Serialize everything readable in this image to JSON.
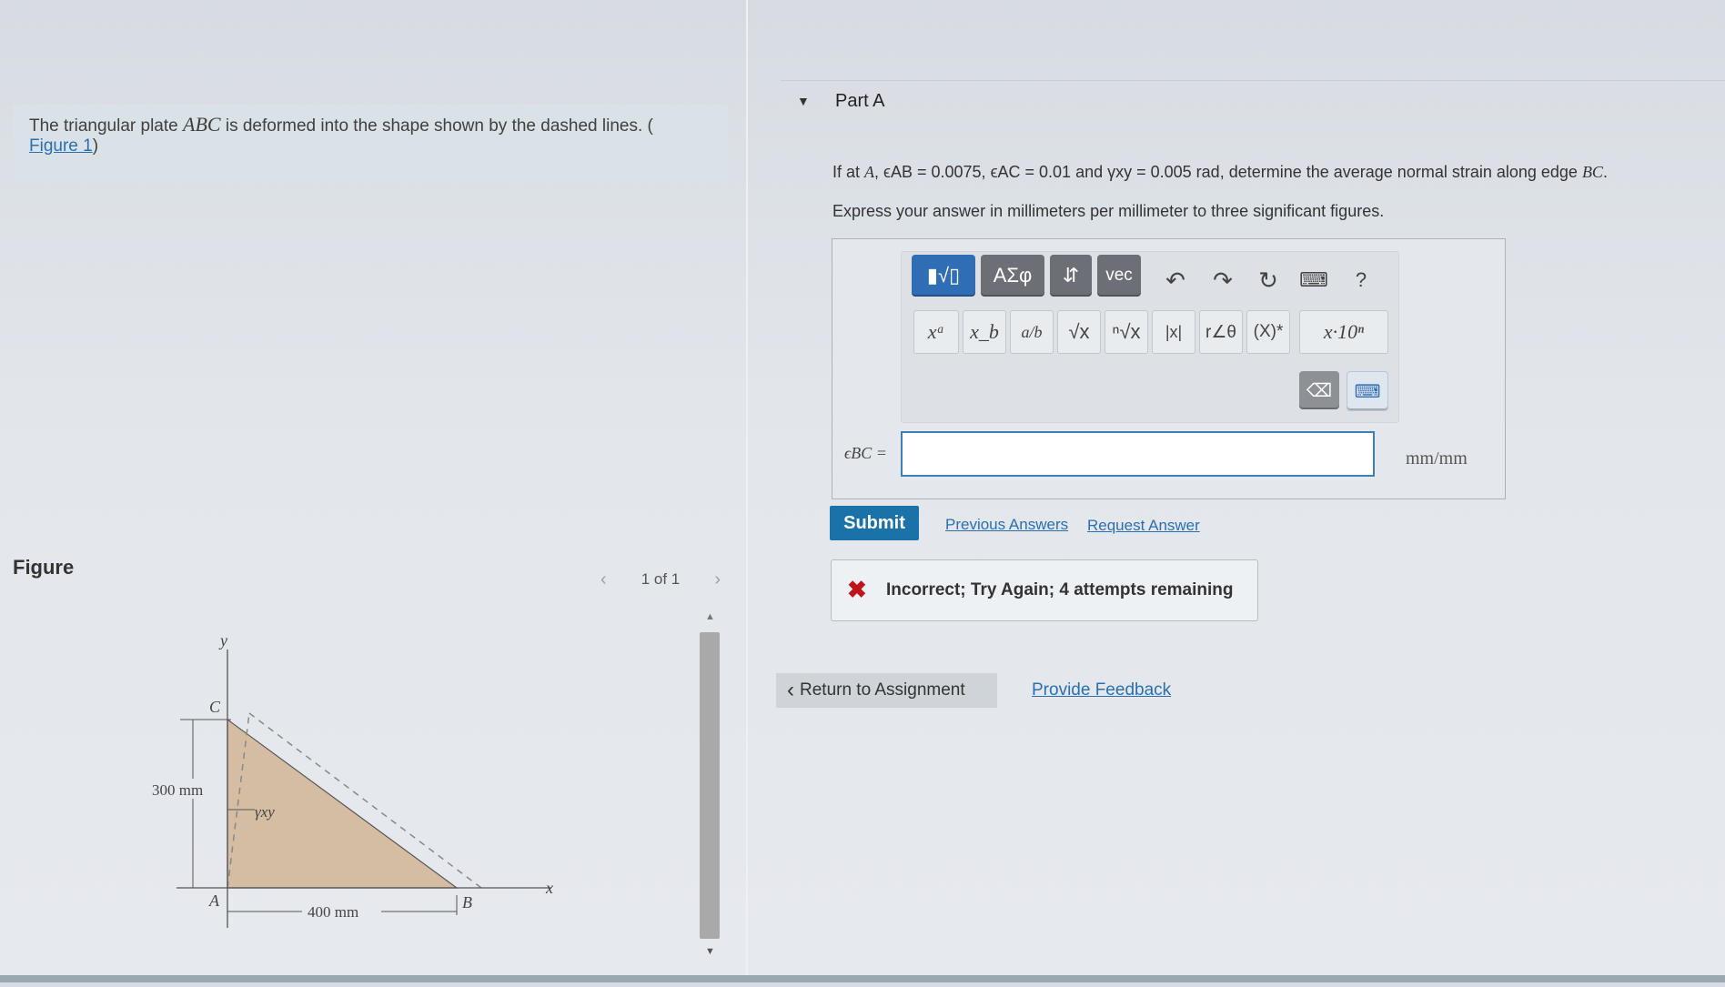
{
  "problem": {
    "text_before": "The triangular plate ",
    "var": "ABC",
    "text_after": " is deformed into the shape shown by the dashed lines. (",
    "figure_link": "Figure 1",
    "close_paren": ")"
  },
  "figure": {
    "heading": "Figure",
    "pager": "1 of 1",
    "labels": {
      "y_axis": "y",
      "x_axis": "x",
      "point_a": "A",
      "point_b": "B",
      "point_c": "C",
      "height": "300 mm",
      "width": "400 mm",
      "gamma": "γxy"
    }
  },
  "part": {
    "title": "Part A",
    "question_prefix": "If at ",
    "point": "A",
    "cond1": ", ϵAB = 0.0075, ",
    "cond2": "ϵAC = 0.01 and ",
    "cond3": "γxy = 0.005 rad",
    "question_suffix": ", determine the average normal strain along edge ",
    "edge": "BC",
    "question_end": ".",
    "instruction": "Express your answer in millimeters per millimeter to three significant figures."
  },
  "toolbar": {
    "templates": "▮√▯",
    "greek": "ΑΣφ",
    "arrows": "⇵",
    "vec": "vec",
    "help": "?",
    "math_buttons": [
      "xᵃ",
      "x_b",
      "a/b",
      "√x",
      "ⁿ√x",
      "|x|",
      "r∠θ",
      "(X)*",
      "x·10ⁿ"
    ]
  },
  "answer": {
    "label": "ϵBC =",
    "value": "",
    "unit": "mm/mm"
  },
  "actions": {
    "submit": "Submit",
    "previous_answers": "Previous Answers",
    "request_answer": "Request Answer"
  },
  "feedback": {
    "message": "Incorrect; Try Again; 4 attempts remaining"
  },
  "footer": {
    "return": "Return to Assignment",
    "provide_feedback": "Provide Feedback"
  }
}
